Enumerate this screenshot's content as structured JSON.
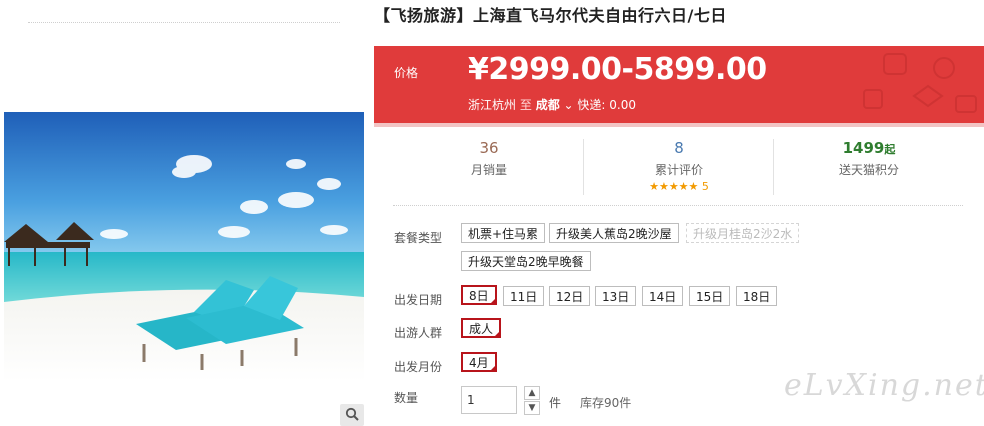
{
  "product": {
    "title": "【飞扬旅游】上海直飞马尔代夫自由行六日/七日"
  },
  "price": {
    "label": "价格",
    "value": "¥2999.00-5899.00",
    "from_city": "浙江杭州",
    "to_word": "至",
    "dest_city": "成都",
    "shipping": "快递: 0.00"
  },
  "stats": {
    "monthly_sales": {
      "value": "36",
      "label": "月销量",
      "color": "#9a6a55"
    },
    "reviews": {
      "value": "8",
      "label": "累计评价",
      "stars": "★★★★★",
      "score": "5",
      "color": "#4a7ab0"
    },
    "points": {
      "value": "1499",
      "suffix": "起",
      "label": "送天猫积分",
      "color": "#2f7d2f"
    }
  },
  "options": {
    "package": {
      "label": "套餐类型",
      "items": [
        "机票+住马累",
        "升级美人蕉岛2晚沙屋",
        "升级月桂岛2沙2水",
        "升级天堂岛2晚早晚餐"
      ]
    },
    "date": {
      "label": "出发日期",
      "items": [
        "8日",
        "11日",
        "12日",
        "13日",
        "14日",
        "15日",
        "18日"
      ]
    },
    "group": {
      "label": "出游人群",
      "items": [
        "成人"
      ]
    },
    "month": {
      "label": "出发月份",
      "items": [
        "4月"
      ]
    },
    "quantity": {
      "label": "数量",
      "value": "1",
      "unit": "件",
      "stock": "库存90件"
    }
  },
  "watermark": "eLvXing.net",
  "colors": {
    "accent": "#e03b3b",
    "selected_border": "#b8141b"
  }
}
